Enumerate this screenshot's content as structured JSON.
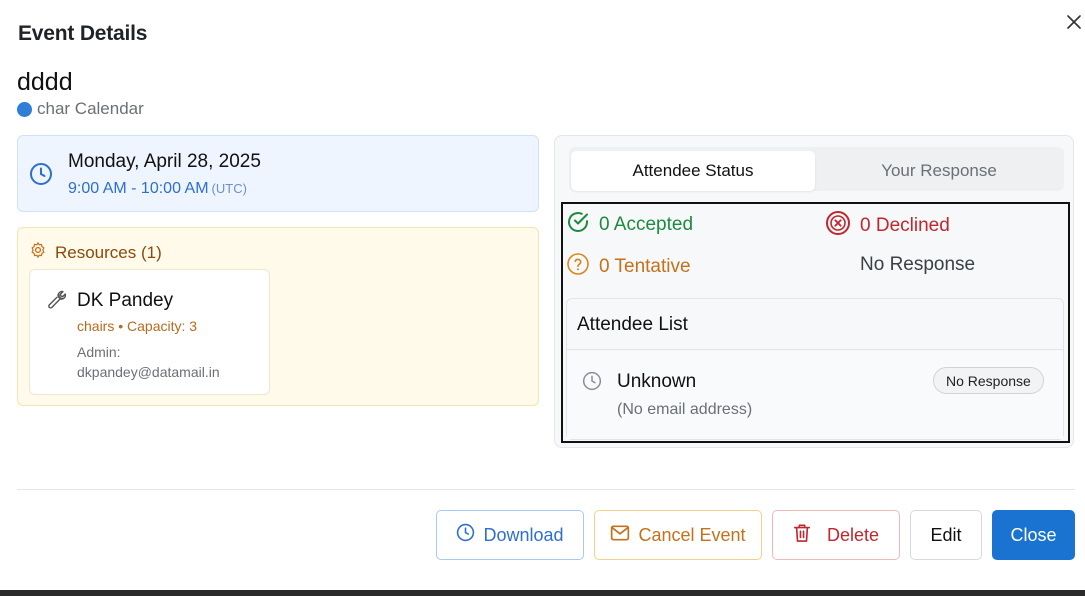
{
  "dialog": {
    "title": "Event Details",
    "close_icon": "close-icon"
  },
  "event": {
    "name": "dddd",
    "calendar": "char Calendar",
    "calendar_color": "#2f7fd8"
  },
  "schedule": {
    "date": "Monday, April 28, 2025",
    "time": "9:00 AM - 10:00 AM",
    "timezone": "(UTC)"
  },
  "resources": {
    "heading": "Resources (1)",
    "items": [
      {
        "name": "DK Pandey",
        "meta": "chairs • Capacity: 3",
        "admin_label": "Admin:",
        "admin_email": "dkpandey@datamail.in"
      }
    ]
  },
  "attendees": {
    "tabs": [
      {
        "label": "Attendee Status",
        "active": true
      },
      {
        "label": "Your Response",
        "active": false
      }
    ],
    "counts": {
      "accepted": "0 Accepted",
      "declined": "0 Declined",
      "tentative": "0 Tentative",
      "no_response": "No Response"
    },
    "list_heading": "Attendee List",
    "list": [
      {
        "name": "Unknown",
        "email": "(No email address)",
        "status": "No Response"
      }
    ]
  },
  "footer": {
    "download": "Download",
    "cancel_event": "Cancel Event",
    "delete": "Delete",
    "edit": "Edit",
    "close": "Close"
  },
  "colors": {
    "accent": "#1a73d1",
    "accepted": "#1e8a3e",
    "declined": "#c0262d",
    "tentative": "#c4711a"
  }
}
